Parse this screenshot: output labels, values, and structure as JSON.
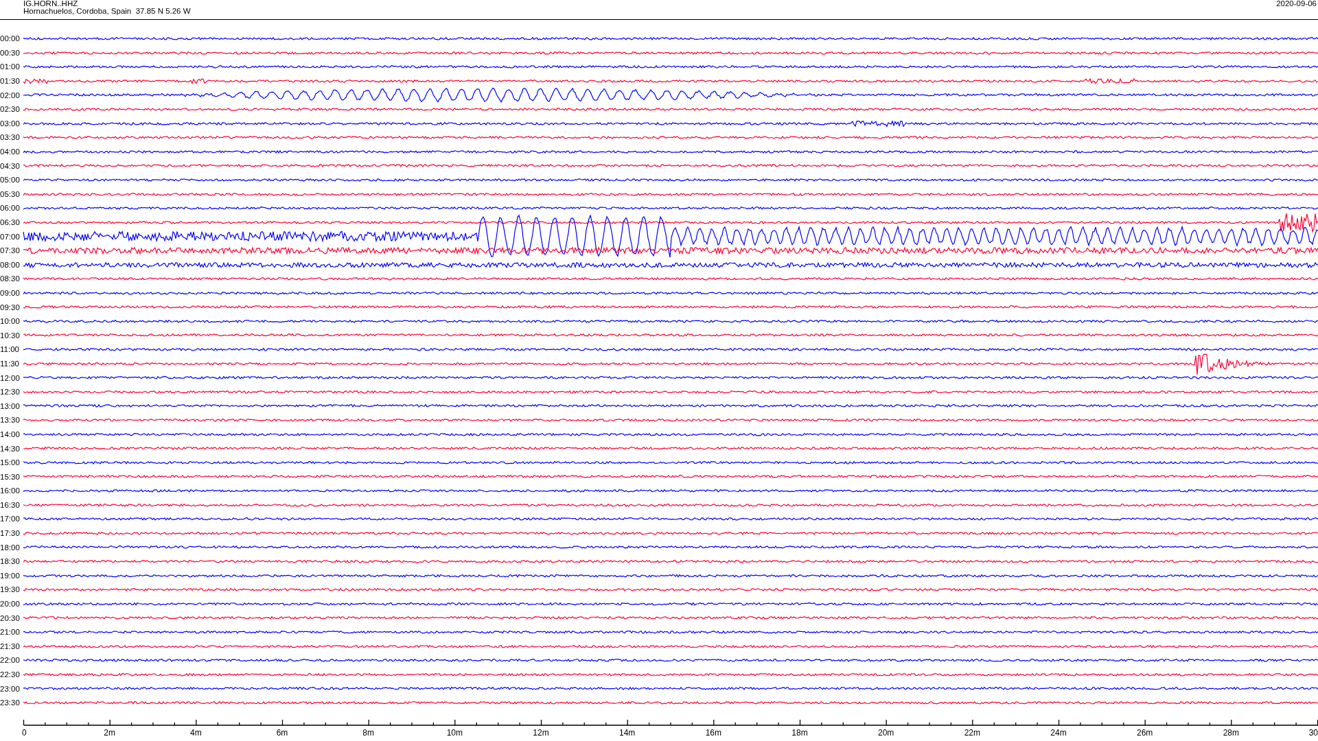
{
  "header": {
    "station": "IG.HORN..HHZ",
    "location": "Hornachuelos, Cordoba, Spain  37.85 N 5.26 W",
    "date": "2020-09-06"
  },
  "traces": [
    {
      "time": "00:00",
      "color": "#0000ff"
    },
    {
      "time": "00:30",
      "color": "#ff0033"
    },
    {
      "time": "01:00",
      "color": "#0000ff"
    },
    {
      "time": "01:30",
      "color": "#ff0033"
    },
    {
      "time": "02:00",
      "color": "#0000ff"
    },
    {
      "time": "02:30",
      "color": "#ff0033"
    },
    {
      "time": "03:00",
      "color": "#0000ff"
    },
    {
      "time": "03:30",
      "color": "#ff0033"
    },
    {
      "time": "04:00",
      "color": "#0000ff"
    },
    {
      "time": "04:30",
      "color": "#ff0033"
    },
    {
      "time": "05:00",
      "color": "#0000ff"
    },
    {
      "time": "05:30",
      "color": "#ff0033"
    },
    {
      "time": "06:00",
      "color": "#0000ff"
    },
    {
      "time": "06:30",
      "color": "#ff0033"
    },
    {
      "time": "07:00",
      "color": "#0000ff"
    },
    {
      "time": "07:30",
      "color": "#ff0033"
    },
    {
      "time": "08:00",
      "color": "#0000ff"
    },
    {
      "time": "08:30",
      "color": "#ff0033"
    },
    {
      "time": "09:00",
      "color": "#0000ff"
    },
    {
      "time": "09:30",
      "color": "#ff0033"
    },
    {
      "time": "10:00",
      "color": "#0000ff"
    },
    {
      "time": "10:30",
      "color": "#ff0033"
    },
    {
      "time": "11:00",
      "color": "#0000ff"
    },
    {
      "time": "11:30",
      "color": "#ff0033"
    },
    {
      "time": "12:00",
      "color": "#0000ff"
    },
    {
      "time": "12:30",
      "color": "#ff0033"
    },
    {
      "time": "13:00",
      "color": "#0000ff"
    },
    {
      "time": "13:30",
      "color": "#ff0033"
    },
    {
      "time": "14:00",
      "color": "#0000ff"
    },
    {
      "time": "14:30",
      "color": "#ff0033"
    },
    {
      "time": "15:00",
      "color": "#0000ff"
    },
    {
      "time": "15:30",
      "color": "#ff0033"
    },
    {
      "time": "16:00",
      "color": "#0000ff"
    },
    {
      "time": "16:30",
      "color": "#ff0033"
    },
    {
      "time": "17:00",
      "color": "#0000ff"
    },
    {
      "time": "17:30",
      "color": "#ff0033"
    },
    {
      "time": "18:00",
      "color": "#0000ff"
    },
    {
      "time": "18:30",
      "color": "#ff0033"
    },
    {
      "time": "19:00",
      "color": "#0000ff"
    },
    {
      "time": "19:30",
      "color": "#ff0033"
    },
    {
      "time": "20:00",
      "color": "#0000ff"
    },
    {
      "time": "20:30",
      "color": "#ff0033"
    },
    {
      "time": "21:00",
      "color": "#0000ff"
    },
    {
      "time": "21:30",
      "color": "#ff0033"
    },
    {
      "time": "22:00",
      "color": "#0000ff"
    },
    {
      "time": "22:30",
      "color": "#ff0033"
    },
    {
      "time": "23:00",
      "color": "#0000ff"
    },
    {
      "time": "23:30",
      "color": "#ff0033"
    }
  ],
  "x_axis": {
    "ticks": [
      "0",
      "2m",
      "4m",
      "6m",
      "8m",
      "10m",
      "12m",
      "14m",
      "16m",
      "18m",
      "20m",
      "22m",
      "24m",
      "26m",
      "28m",
      "30"
    ]
  }
}
